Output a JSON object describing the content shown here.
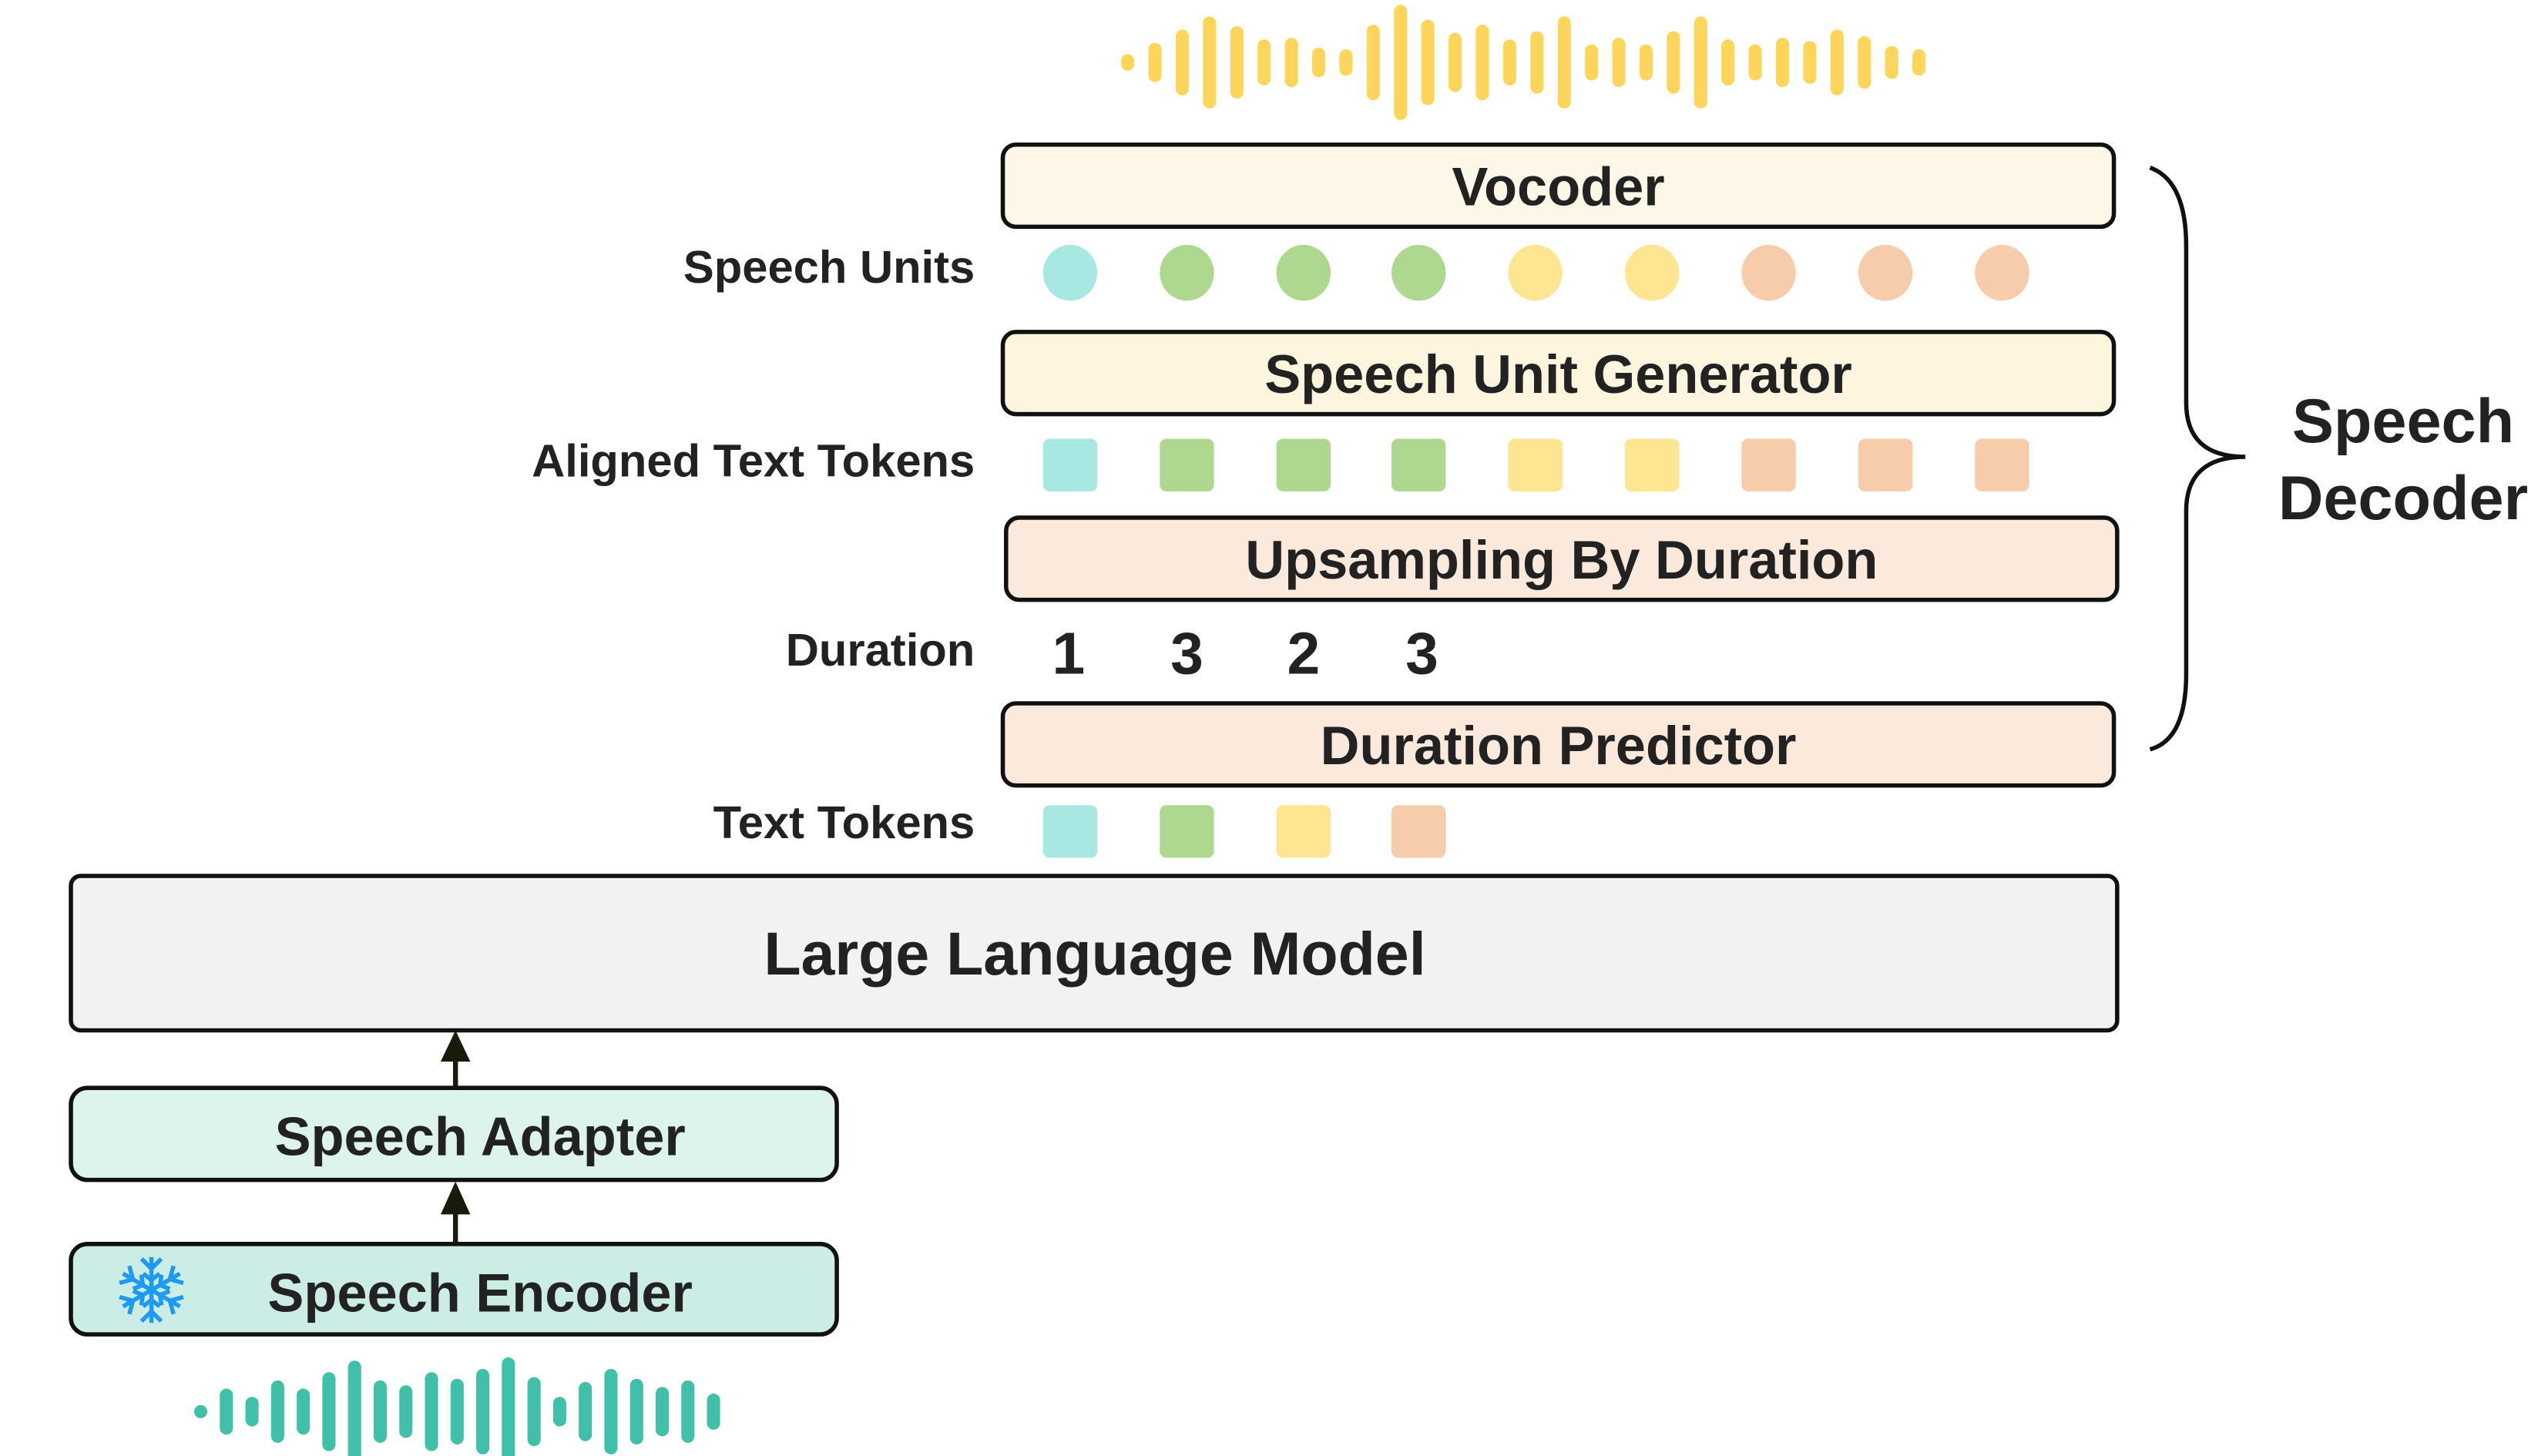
{
  "labels": {
    "speech_units": "Speech Units",
    "aligned_text_tokens": "Aligned Text Tokens",
    "duration": "Duration",
    "text_tokens": "Text Tokens"
  },
  "blocks": {
    "vocoder": "Vocoder",
    "speech_unit_generator": "Speech Unit Generator",
    "upsampling": "Upsampling By Duration",
    "duration_predictor": "Duration Predictor",
    "llm": "Large Language Model",
    "speech_adapter": "Speech Adapter",
    "speech_encoder": "Speech Encoder"
  },
  "speech_decoder": {
    "line1": "Speech",
    "line2": "Decoder"
  },
  "durations": [
    "1",
    "3",
    "2",
    "3"
  ],
  "token_colors": [
    "#a8e8e2",
    "#aed88f",
    "#fde592",
    "#f6ccab"
  ],
  "speech_unit_color_index": [
    0,
    1,
    1,
    1,
    2,
    2,
    3,
    3,
    3
  ],
  "text_token_color_index": [
    0,
    1,
    2,
    3
  ],
  "colors": {
    "output_wave": "#fcd55a",
    "input_wave": "#40c0a8",
    "snowflake": "#1e9bf0",
    "vocoder_fill": "#fdf7e8",
    "generator_fill": "#fdf5de",
    "duration_fill": "#fbe9dc",
    "llm_fill": "#f2f2f2",
    "adapter_fill": "#dcf3ee",
    "encoder_fill": "#ccede6"
  },
  "icons": {
    "frozen": "snowflake-icon",
    "output": "waveform-icon",
    "input": "waveform-icon"
  }
}
